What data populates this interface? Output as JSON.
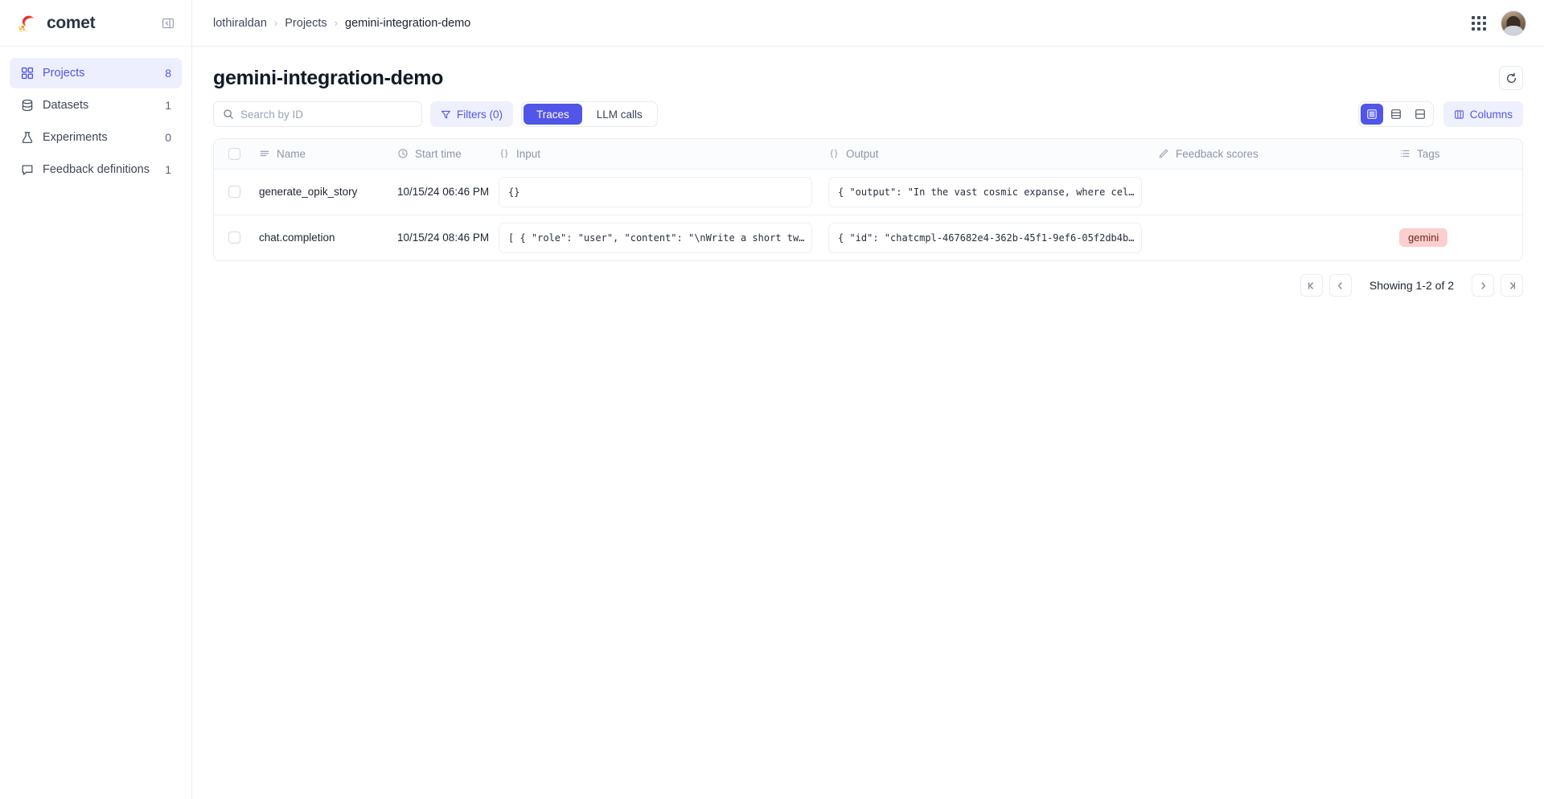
{
  "sidebar": {
    "brand": "comet",
    "collapse_icon": "panel-collapse-icon",
    "items": [
      {
        "label": "Projects",
        "count": "8",
        "icon": "grid-squares-icon",
        "active": true
      },
      {
        "label": "Datasets",
        "count": "1",
        "icon": "database-icon",
        "active": false
      },
      {
        "label": "Experiments",
        "count": "0",
        "icon": "flask-icon",
        "active": false
      },
      {
        "label": "Feedback definitions",
        "count": "1",
        "icon": "comment-icon",
        "active": false
      }
    ]
  },
  "topbar": {
    "breadcrumb": [
      "lothiraldan",
      "Projects",
      "gemini-integration-demo"
    ],
    "separator": "›",
    "apps_icon": "grid-apps-icon",
    "avatar": "user-avatar"
  },
  "page": {
    "title": "gemini-integration-demo",
    "refresh_icon": "refresh-icon"
  },
  "toolbar": {
    "search_placeholder": "Search by ID",
    "search_value": "",
    "search_icon": "search-icon",
    "filters_label": "Filters (0)",
    "filters_icon": "filter-icon",
    "tabs": [
      {
        "label": "Traces",
        "active": true
      },
      {
        "label": "LLM calls",
        "active": false
      }
    ],
    "row_height_options": [
      {
        "icon": "rows-small-icon",
        "active": true
      },
      {
        "icon": "rows-medium-icon",
        "active": false
      },
      {
        "icon": "rows-large-icon",
        "active": false
      }
    ],
    "columns_label": "Columns",
    "columns_icon": "columns-icon"
  },
  "table": {
    "columns": [
      {
        "key": "name",
        "label": "Name",
        "icon": "text-lines-icon"
      },
      {
        "key": "start_time",
        "label": "Start time",
        "icon": "clock-icon"
      },
      {
        "key": "input",
        "label": "Input",
        "icon": "braces-icon"
      },
      {
        "key": "output",
        "label": "Output",
        "icon": "braces-icon"
      },
      {
        "key": "feedback_scores",
        "label": "Feedback scores",
        "icon": "pencil-icon"
      },
      {
        "key": "tags",
        "label": "Tags",
        "icon": "list-icon"
      }
    ],
    "rows": [
      {
        "name": "generate_opik_story",
        "start_time": "10/15/24 06:46 PM",
        "input": "{}",
        "output": "{ \"output\": \"In the vast cosmic expanse, where cel…",
        "feedback_scores": "",
        "tags": []
      },
      {
        "name": "chat.completion",
        "start_time": "10/15/24 08:46 PM",
        "input": "[ { \"role\": \"user\", \"content\": \"\\nWrite a short tw…",
        "output": "{ \"id\": \"chatcmpl-467682e4-362b-45f1-9ef6-05f2db4b…",
        "feedback_scores": "",
        "tags": [
          {
            "label": "gemini",
            "bg": "#fbcfce",
            "color": "#71221f"
          }
        ]
      }
    ]
  },
  "pagination": {
    "first_label": "⇤",
    "prev_label": "‹",
    "info": "Showing 1-2 of 2",
    "next_label": "›",
    "last_label": "⇥"
  },
  "colors": {
    "accent": "#5155e8",
    "accent_soft": "#eff0fd",
    "border": "#e9ecf2",
    "muted_text": "#8c95a8"
  }
}
